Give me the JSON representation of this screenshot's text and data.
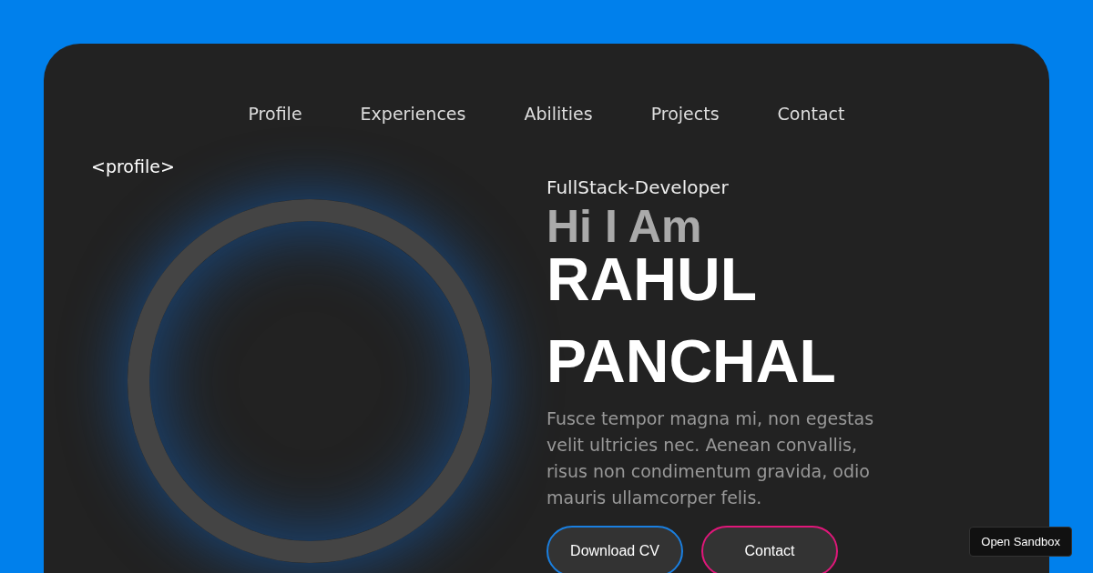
{
  "nav": {
    "items": [
      {
        "label": "Profile"
      },
      {
        "label": "Experiences"
      },
      {
        "label": "Abilities"
      },
      {
        "label": "Projects"
      },
      {
        "label": "Contact"
      }
    ]
  },
  "section_tag": "<profile>",
  "hero": {
    "subtitle": "FullStack-Developer",
    "greeting": "Hi I Am",
    "name": "RAHUL PANCHAL",
    "description": "Fusce tempor magna mi, non egestas velit ultricies nec. Aenean convallis, risus non condimentum gravida, odio mauris ullamcorper felis.",
    "buttons": [
      {
        "label": "Download CV",
        "color": "#1a7fe0"
      },
      {
        "label": "Contact",
        "color": "#e0177a"
      }
    ]
  },
  "sandbox_button": "Open Sandbox"
}
